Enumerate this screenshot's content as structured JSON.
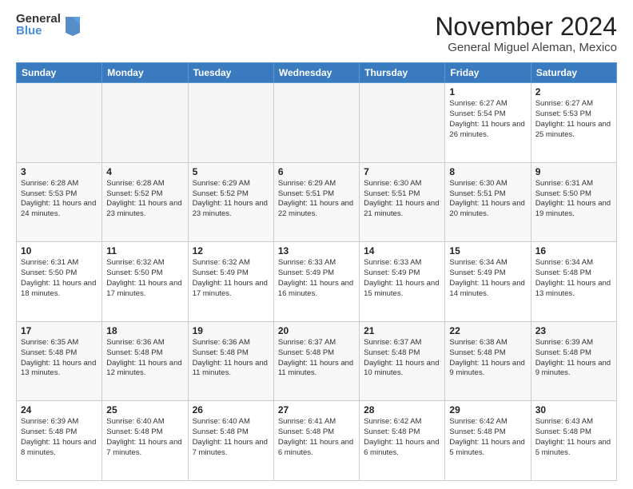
{
  "logo": {
    "general": "General",
    "blue": "Blue"
  },
  "header": {
    "month": "November 2024",
    "location": "General Miguel Aleman, Mexico"
  },
  "days": [
    "Sunday",
    "Monday",
    "Tuesday",
    "Wednesday",
    "Thursday",
    "Friday",
    "Saturday"
  ],
  "weeks": [
    [
      {
        "day": "",
        "info": "",
        "empty": true
      },
      {
        "day": "",
        "info": "",
        "empty": true
      },
      {
        "day": "",
        "info": "",
        "empty": true
      },
      {
        "day": "",
        "info": "",
        "empty": true
      },
      {
        "day": "",
        "info": "",
        "empty": true
      },
      {
        "day": "1",
        "info": "Sunrise: 6:27 AM\nSunset: 5:54 PM\nDaylight: 11 hours and 26 minutes."
      },
      {
        "day": "2",
        "info": "Sunrise: 6:27 AM\nSunset: 5:53 PM\nDaylight: 11 hours and 25 minutes."
      }
    ],
    [
      {
        "day": "3",
        "info": "Sunrise: 6:28 AM\nSunset: 5:53 PM\nDaylight: 11 hours and 24 minutes."
      },
      {
        "day": "4",
        "info": "Sunrise: 6:28 AM\nSunset: 5:52 PM\nDaylight: 11 hours and 23 minutes."
      },
      {
        "day": "5",
        "info": "Sunrise: 6:29 AM\nSunset: 5:52 PM\nDaylight: 11 hours and 23 minutes."
      },
      {
        "day": "6",
        "info": "Sunrise: 6:29 AM\nSunset: 5:51 PM\nDaylight: 11 hours and 22 minutes."
      },
      {
        "day": "7",
        "info": "Sunrise: 6:30 AM\nSunset: 5:51 PM\nDaylight: 11 hours and 21 minutes."
      },
      {
        "day": "8",
        "info": "Sunrise: 6:30 AM\nSunset: 5:51 PM\nDaylight: 11 hours and 20 minutes."
      },
      {
        "day": "9",
        "info": "Sunrise: 6:31 AM\nSunset: 5:50 PM\nDaylight: 11 hours and 19 minutes."
      }
    ],
    [
      {
        "day": "10",
        "info": "Sunrise: 6:31 AM\nSunset: 5:50 PM\nDaylight: 11 hours and 18 minutes."
      },
      {
        "day": "11",
        "info": "Sunrise: 6:32 AM\nSunset: 5:50 PM\nDaylight: 11 hours and 17 minutes."
      },
      {
        "day": "12",
        "info": "Sunrise: 6:32 AM\nSunset: 5:49 PM\nDaylight: 11 hours and 17 minutes."
      },
      {
        "day": "13",
        "info": "Sunrise: 6:33 AM\nSunset: 5:49 PM\nDaylight: 11 hours and 16 minutes."
      },
      {
        "day": "14",
        "info": "Sunrise: 6:33 AM\nSunset: 5:49 PM\nDaylight: 11 hours and 15 minutes."
      },
      {
        "day": "15",
        "info": "Sunrise: 6:34 AM\nSunset: 5:49 PM\nDaylight: 11 hours and 14 minutes."
      },
      {
        "day": "16",
        "info": "Sunrise: 6:34 AM\nSunset: 5:48 PM\nDaylight: 11 hours and 13 minutes."
      }
    ],
    [
      {
        "day": "17",
        "info": "Sunrise: 6:35 AM\nSunset: 5:48 PM\nDaylight: 11 hours and 13 minutes."
      },
      {
        "day": "18",
        "info": "Sunrise: 6:36 AM\nSunset: 5:48 PM\nDaylight: 11 hours and 12 minutes."
      },
      {
        "day": "19",
        "info": "Sunrise: 6:36 AM\nSunset: 5:48 PM\nDaylight: 11 hours and 11 minutes."
      },
      {
        "day": "20",
        "info": "Sunrise: 6:37 AM\nSunset: 5:48 PM\nDaylight: 11 hours and 11 minutes."
      },
      {
        "day": "21",
        "info": "Sunrise: 6:37 AM\nSunset: 5:48 PM\nDaylight: 11 hours and 10 minutes."
      },
      {
        "day": "22",
        "info": "Sunrise: 6:38 AM\nSunset: 5:48 PM\nDaylight: 11 hours and 9 minutes."
      },
      {
        "day": "23",
        "info": "Sunrise: 6:39 AM\nSunset: 5:48 PM\nDaylight: 11 hours and 9 minutes."
      }
    ],
    [
      {
        "day": "24",
        "info": "Sunrise: 6:39 AM\nSunset: 5:48 PM\nDaylight: 11 hours and 8 minutes."
      },
      {
        "day": "25",
        "info": "Sunrise: 6:40 AM\nSunset: 5:48 PM\nDaylight: 11 hours and 7 minutes."
      },
      {
        "day": "26",
        "info": "Sunrise: 6:40 AM\nSunset: 5:48 PM\nDaylight: 11 hours and 7 minutes."
      },
      {
        "day": "27",
        "info": "Sunrise: 6:41 AM\nSunset: 5:48 PM\nDaylight: 11 hours and 6 minutes."
      },
      {
        "day": "28",
        "info": "Sunrise: 6:42 AM\nSunset: 5:48 PM\nDaylight: 11 hours and 6 minutes."
      },
      {
        "day": "29",
        "info": "Sunrise: 6:42 AM\nSunset: 5:48 PM\nDaylight: 11 hours and 5 minutes."
      },
      {
        "day": "30",
        "info": "Sunrise: 6:43 AM\nSunset: 5:48 PM\nDaylight: 11 hours and 5 minutes."
      }
    ]
  ]
}
